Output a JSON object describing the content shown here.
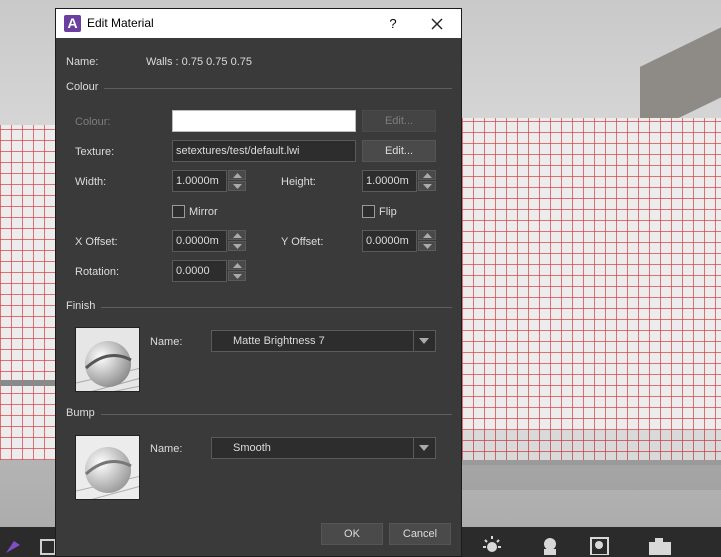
{
  "dialog": {
    "title": "Edit Material",
    "help_label": "?",
    "app_icon_letter": "A",
    "name_label": "Name:",
    "name_value": "Walls : 0.75 0.75 0.75"
  },
  "colour_section": {
    "header": "Colour",
    "colour_label": "Colour:",
    "colour_value": "#ffffff",
    "colour_edit": "Edit...",
    "texture_label": "Texture:",
    "texture_value": "setextures/test/default.lwi",
    "texture_edit": "Edit...",
    "width_label": "Width:",
    "width_value": "1.0000m",
    "height_label": "Height:",
    "height_value": "1.0000m",
    "mirror_label": "Mirror",
    "mirror_checked": false,
    "flip_label": "Flip",
    "flip_checked": false,
    "xoffset_label": "X Offset:",
    "xoffset_value": "0.0000m",
    "yoffset_label": "Y Offset:",
    "yoffset_value": "0.0000m",
    "rotation_label": "Rotation:",
    "rotation_value": "0.0000"
  },
  "finish_section": {
    "header": "Finish",
    "name_label": "Name:",
    "selected": "Matte Brightness 7"
  },
  "bump_section": {
    "header": "Bump",
    "name_label": "Name:",
    "selected": "Smooth"
  },
  "buttons": {
    "ok": "OK",
    "cancel": "Cancel"
  },
  "colors": {
    "dialog_bg": "#3a3a3a",
    "field_bg": "#2d2d2d",
    "accent_app": "#6b3fa0",
    "grid_line": "#d64650"
  }
}
